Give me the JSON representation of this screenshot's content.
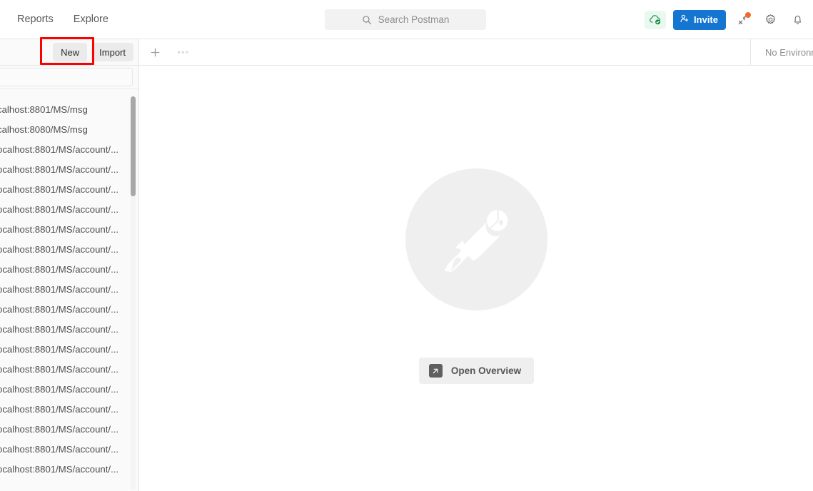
{
  "header": {
    "nav_items": [
      {
        "label": "Reports",
        "name": "topnav-reports"
      },
      {
        "label": "Explore",
        "name": "topnav-explore"
      }
    ],
    "search": {
      "placeholder": "Search Postman",
      "value": ""
    },
    "sync_status_icon": "cloud-check-icon",
    "invite_label": "Invite",
    "right_icons": [
      {
        "name": "satellite-icon",
        "has_notification": true
      },
      {
        "name": "gear-icon",
        "has_notification": false
      },
      {
        "name": "bell-icon",
        "has_notification": false
      }
    ]
  },
  "actionbar": {
    "new_label": "New",
    "import_label": "Import",
    "highlight_color": "#ff0000"
  },
  "tabbar": {
    "new_tab_icon": "plus-icon",
    "more_icon": "ellipsis-icon",
    "environment_label": "No Environm"
  },
  "sidebar": {
    "filter": {
      "placeholder": "",
      "value": ""
    },
    "more_icon": "ellipsis-icon",
    "requests": [
      {
        "label": "calhost:8801/MS/msg"
      },
      {
        "label": "calhost:8080/MS/msg"
      },
      {
        "label": "ocalhost:8801/MS/account/..."
      },
      {
        "label": "ocalhost:8801/MS/account/..."
      },
      {
        "label": "ocalhost:8801/MS/account/..."
      },
      {
        "label": "ocalhost:8801/MS/account/..."
      },
      {
        "label": "ocalhost:8801/MS/account/..."
      },
      {
        "label": "ocalhost:8801/MS/account/..."
      },
      {
        "label": "ocalhost:8801/MS/account/..."
      },
      {
        "label": "ocalhost:8801/MS/account/..."
      },
      {
        "label": "ocalhost:8801/MS/account/..."
      },
      {
        "label": "ocalhost:8801/MS/account/..."
      },
      {
        "label": "ocalhost:8801/MS/account/..."
      },
      {
        "label": "ocalhost:8801/MS/account/..."
      },
      {
        "label": "ocalhost:8801/MS/account/..."
      },
      {
        "label": "ocalhost:8801/MS/account/..."
      },
      {
        "label": "ocalhost:8801/MS/account/..."
      },
      {
        "label": "ocalhost:8801/MS/account/..."
      },
      {
        "label": "ocalhost:8801/MS/account/..."
      }
    ]
  },
  "main": {
    "hero_icon": "postman-pen-icon",
    "open_overview_label": "Open Overview",
    "open_overview_icon": "external-link-icon"
  },
  "colors": {
    "accent_blue": "#1576d2",
    "notification_orange": "#f8682c",
    "sync_green": "#128a3f",
    "highlight_red": "#ff0000"
  }
}
